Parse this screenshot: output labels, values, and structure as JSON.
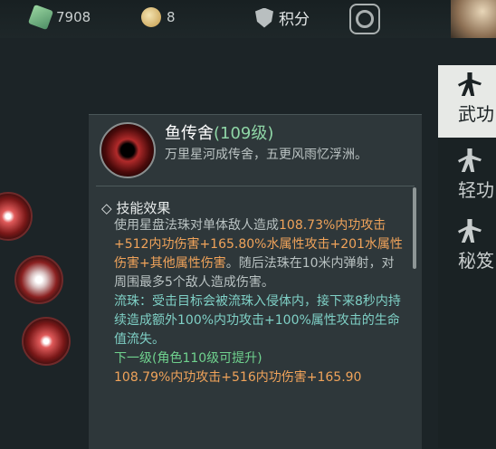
{
  "topbar": {
    "gems": "7908",
    "gold": "8",
    "score_label": "积分"
  },
  "tabs": [
    {
      "label": "武功",
      "active": true
    },
    {
      "label": "轻功",
      "active": false
    },
    {
      "label": "秘笈",
      "active": false
    }
  ],
  "skill": {
    "name": "鱼传舍",
    "level": "(109级)",
    "description": "万里星河成传舍，五更风雨忆浮洲。",
    "section_title": "技能效果",
    "effect": {
      "t1": "使用星盘法珠对单体敌人造成",
      "h1": "108.73%内功攻击+512内功伤害+165.80%水属性攻击+201水属性伤害+其他属性伤害",
      "t2": "。随后法珠在10米内弹射，对周围最多5个敌人造成伤害。"
    },
    "liuzhu": "流珠：受击目标会被流珠入侵体内，接下来8秒内持续造成额外100%内功攻击+100%属性攻击的生命值流失。",
    "next_level_title": "下一级(角色110级可提升)",
    "next_level_value": "108.79%内功攻击+516内功伤害+165.90"
  }
}
